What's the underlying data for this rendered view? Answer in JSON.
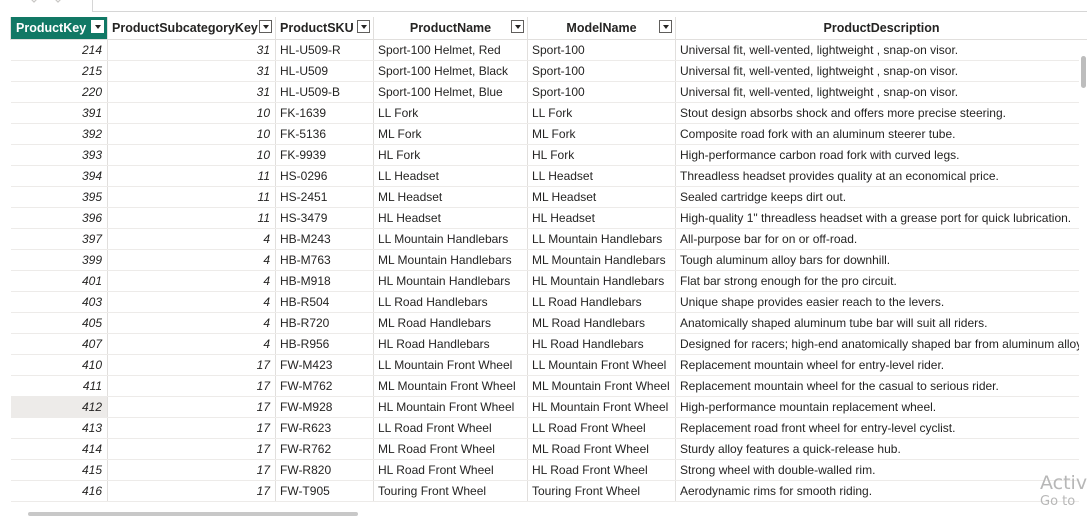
{
  "table": {
    "columns": [
      "ProductKey",
      "ProductSubcategoryKey",
      "ProductSKU",
      "ProductName",
      "ModelName",
      "ProductDescription"
    ],
    "rows": [
      [
        "214",
        "31",
        "HL-U509-R",
        "Sport-100 Helmet, Red",
        "Sport-100",
        "Universal fit, well-vented, lightweight , snap-on visor."
      ],
      [
        "215",
        "31",
        "HL-U509",
        "Sport-100 Helmet, Black",
        "Sport-100",
        "Universal fit, well-vented, lightweight , snap-on visor."
      ],
      [
        "220",
        "31",
        "HL-U509-B",
        "Sport-100 Helmet, Blue",
        "Sport-100",
        "Universal fit, well-vented, lightweight , snap-on visor."
      ],
      [
        "391",
        "10",
        "FK-1639",
        "LL Fork",
        "LL Fork",
        "Stout design absorbs shock and offers more precise steering."
      ],
      [
        "392",
        "10",
        "FK-5136",
        "ML Fork",
        "ML Fork",
        "Composite road fork with an aluminum steerer tube."
      ],
      [
        "393",
        "10",
        "FK-9939",
        "HL Fork",
        "HL Fork",
        "High-performance carbon road fork with curved legs."
      ],
      [
        "394",
        "11",
        "HS-0296",
        "LL Headset",
        "LL Headset",
        "Threadless headset provides quality at an economical price."
      ],
      [
        "395",
        "11",
        "HS-2451",
        "ML Headset",
        "ML Headset",
        "Sealed cartridge keeps dirt out."
      ],
      [
        "396",
        "11",
        "HS-3479",
        "HL Headset",
        "HL Headset",
        "High-quality 1\" threadless headset with a grease port for quick lubrication."
      ],
      [
        "397",
        "4",
        "HB-M243",
        "LL Mountain Handlebars",
        "LL Mountain Handlebars",
        "All-purpose bar for on or off-road."
      ],
      [
        "399",
        "4",
        "HB-M763",
        "ML Mountain Handlebars",
        "ML Mountain Handlebars",
        "Tough aluminum alloy bars for downhill."
      ],
      [
        "401",
        "4",
        "HB-M918",
        "HL Mountain Handlebars",
        "HL Mountain Handlebars",
        "Flat bar strong enough for the pro circuit."
      ],
      [
        "403",
        "4",
        "HB-R504",
        "LL Road Handlebars",
        "LL Road Handlebars",
        "Unique shape provides easier reach to the levers."
      ],
      [
        "405",
        "4",
        "HB-R720",
        "ML Road Handlebars",
        "ML Road Handlebars",
        "Anatomically shaped aluminum tube bar will suit all riders."
      ],
      [
        "407",
        "4",
        "HB-R956",
        "HL Road Handlebars",
        "HL Road Handlebars",
        "Designed for racers; high-end anatomically shaped bar from aluminum alloy."
      ],
      [
        "410",
        "17",
        "FW-M423",
        "LL Mountain Front Wheel",
        "LL Mountain Front Wheel",
        "Replacement mountain wheel for entry-level rider."
      ],
      [
        "411",
        "17",
        "FW-M762",
        "ML Mountain Front Wheel",
        "ML Mountain Front Wheel",
        "Replacement mountain wheel for the casual to serious rider."
      ],
      [
        "412",
        "17",
        "FW-M928",
        "HL Mountain Front Wheel",
        "HL Mountain Front Wheel",
        "High-performance mountain replacement wheel."
      ],
      [
        "413",
        "17",
        "FW-R623",
        "LL Road Front Wheel",
        "LL Road Front Wheel",
        "Replacement road front wheel for entry-level cyclist."
      ],
      [
        "414",
        "17",
        "FW-R762",
        "ML Road Front Wheel",
        "ML Road Front Wheel",
        "Sturdy alloy features a quick-release hub."
      ],
      [
        "415",
        "17",
        "FW-R820",
        "HL Road Front Wheel",
        "HL Road Front Wheel",
        "Strong wheel with double-walled rim."
      ],
      [
        "416",
        "17",
        "FW-T905",
        "Touring Front Wheel",
        "Touring Front Wheel",
        "Aerodynamic rims for smooth riding."
      ]
    ],
    "selected_row_index": 17
  },
  "watermark": {
    "line1": "Activ",
    "line2": "Go to"
  },
  "colors": {
    "header_active": "#117865",
    "grid_line": "#e1dfdd",
    "selected_row": "#edebe9"
  },
  "icons": [
    "undo-icon",
    "redo-icon",
    "filter-dropdown-icon"
  ]
}
